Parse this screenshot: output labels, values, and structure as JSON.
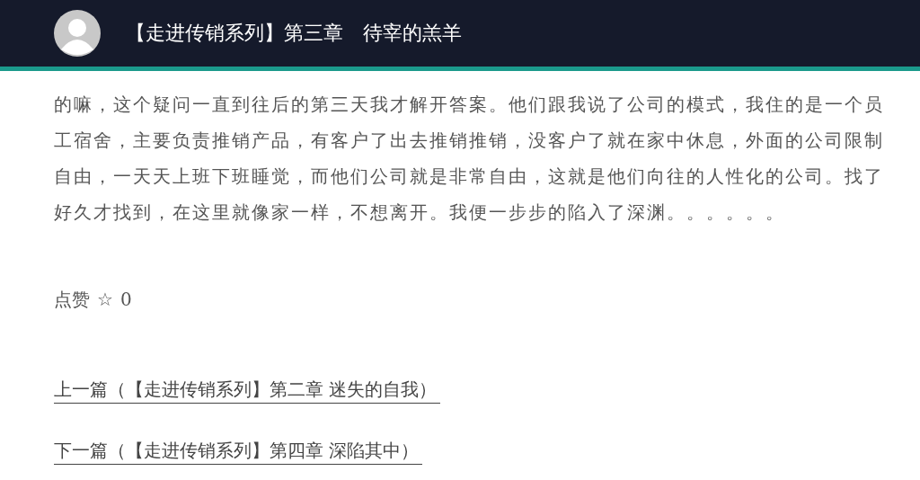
{
  "header": {
    "title": "【走进传销系列】第三章　待宰的羔羊"
  },
  "article": {
    "paragraph": "的嘛，这个疑问一直到往后的第三天我才解开答案。他们跟我说了公司的模式，我住的是一个员工宿舍，主要负责推销产品，有客户了出去推销推销，没客户了就在家中休息，外面的公司限制自由，一天天上班下班睡觉，而他们公司就是非常自由，这就是他们向往的人性化的公司。找了好久才找到，在这里就像家一样，不想离开。我便一步步的陷入了深渊。。。。。。"
  },
  "like": {
    "label": "点赞",
    "icon": "☆",
    "count": "0"
  },
  "nav_links": [
    {
      "text": "上一篇（【走进传销系列】第二章 迷失的自我）"
    },
    {
      "text": "下一篇（【走进传销系列】第四章 深陷其中）"
    }
  ]
}
